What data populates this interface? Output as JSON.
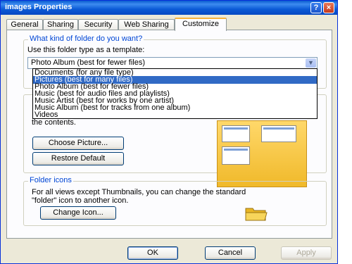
{
  "window": {
    "title": "images Properties",
    "help_glyph": "?",
    "close_glyph": "×"
  },
  "tabs": [
    {
      "label": "General"
    },
    {
      "label": "Sharing"
    },
    {
      "label": "Security"
    },
    {
      "label": "Web Sharing"
    },
    {
      "label": "Customize"
    }
  ],
  "folder_type": {
    "group_title": "What kind of folder do you want?",
    "template_label": "Use this folder type as a template:",
    "selected_value": "Photo Album (best for fewer files)",
    "options": [
      "Documents (for any file type)",
      "Pictures (best for many files)",
      "Photo Album (best for fewer files)",
      "Music (best for audio files and playlists)",
      "Music Artist (best for works by one artist)",
      "Music Album (best for tracks from one album)",
      "Videos"
    ],
    "highlighted_option": "Pictures (best for many files)"
  },
  "folder_pictures": {
    "contents_text": "the contents.",
    "choose_picture_label": "Choose Picture...",
    "restore_default_label": "Restore Default"
  },
  "folder_icons": {
    "group_title": "Folder icons",
    "description_line1": "For all views except Thumbnails, you can change the standard",
    "description_line2": "\"folder\" icon to another icon.",
    "change_icon_label": "Change Icon..."
  },
  "footer": {
    "ok_label": "OK",
    "cancel_label": "Cancel",
    "apply_label": "Apply"
  },
  "colors": {
    "titlebar": "#0a5ccf",
    "selection": "#316ac5",
    "group_title": "#0046d5",
    "active_tab_accent": "#f7b23b"
  }
}
